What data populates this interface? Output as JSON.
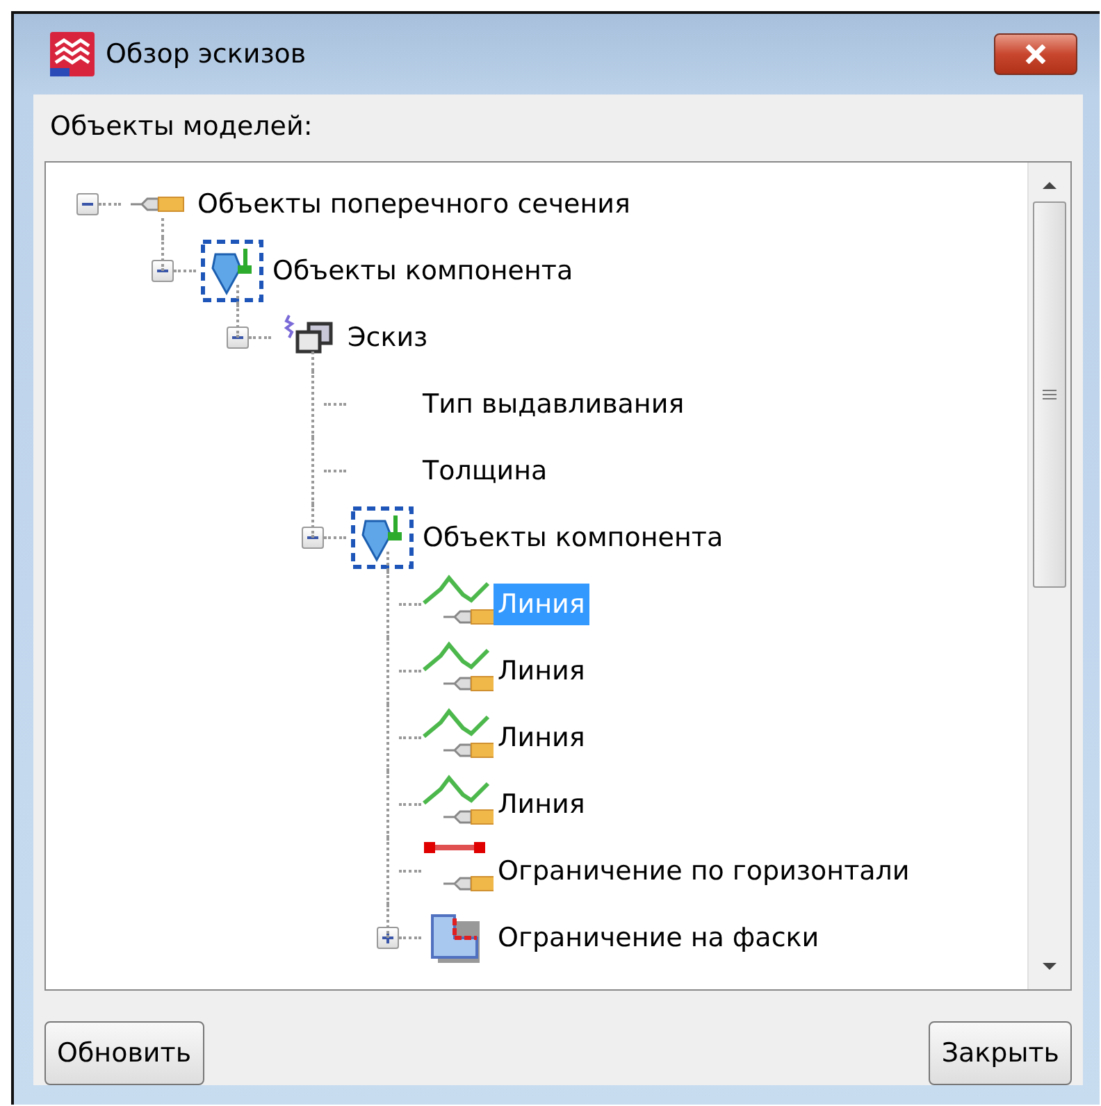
{
  "window": {
    "title": "Обзор эскизов"
  },
  "label": "Объекты моделей:",
  "tree": [
    {
      "kind": "section",
      "label": "Объекты поперечного сечения",
      "expanded": true,
      "selected": false,
      "children": [
        {
          "kind": "component",
          "label": "Объекты компонента",
          "expanded": true,
          "selected": false,
          "children": [
            {
              "kind": "sketch",
              "label": "Эскиз",
              "expanded": true,
              "selected": false,
              "children": [
                {
                  "kind": "property",
                  "label": "Тип выдавливания",
                  "selected": false
                },
                {
                  "kind": "property",
                  "label": "Толщина",
                  "selected": false
                },
                {
                  "kind": "component",
                  "label": "Объекты компонента",
                  "expanded": true,
                  "selected": false,
                  "children": [
                    {
                      "kind": "line",
                      "label": "Линия",
                      "selected": true
                    },
                    {
                      "kind": "line",
                      "label": "Линия",
                      "selected": false
                    },
                    {
                      "kind": "line",
                      "label": "Линия",
                      "selected": false
                    },
                    {
                      "kind": "line",
                      "label": "Линия",
                      "selected": false
                    },
                    {
                      "kind": "horizontal",
                      "label": "Ограничение по горизонтали",
                      "selected": false
                    },
                    {
                      "kind": "chamfer",
                      "label": "Ограничение на фаски",
                      "expanded": false,
                      "selected": false
                    }
                  ]
                }
              ]
            }
          ]
        }
      ]
    }
  ],
  "buttons": [
    "Обновить",
    "Закрыть"
  ]
}
